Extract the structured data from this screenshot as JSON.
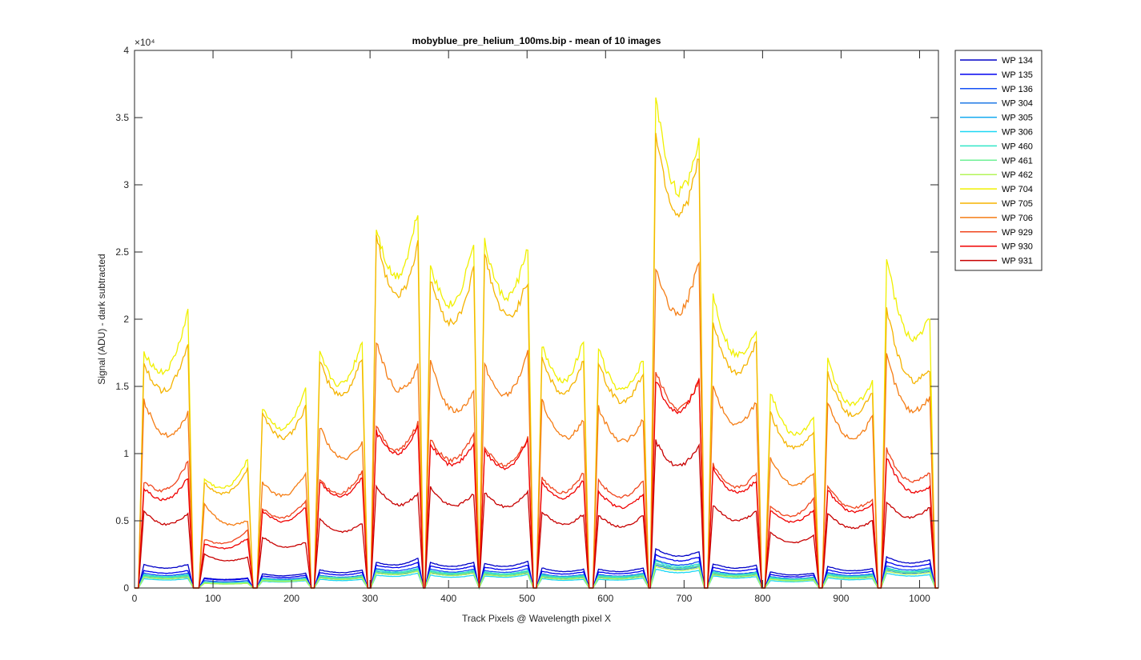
{
  "chart_data": {
    "type": "line",
    "title": "mobyblue_pre_helium_100ms.bip - mean of 10 images",
    "xlabel": "Track Pixels @ Wavelength pixel X",
    "ylabel": "Signal (ADU) - dark subtracted",
    "y_multiplier_label": "×10⁴",
    "xlim": [
      0,
      1024
    ],
    "ylim": [
      0,
      40000
    ],
    "x_ticks": [
      0,
      100,
      200,
      300,
      400,
      500,
      600,
      700,
      800,
      900,
      1000
    ],
    "y_ticks": [
      0,
      5000,
      10000,
      15000,
      20000,
      25000,
      30000,
      35000,
      40000
    ],
    "y_tick_labels": [
      "0",
      "0.5",
      "1",
      "1.5",
      "2",
      "2.5",
      "3",
      "3.5",
      "4"
    ],
    "grid": false,
    "legend_position": "outside-top-right",
    "segments_x": [
      [
        12,
        68
      ],
      [
        89,
        144
      ],
      [
        163,
        218
      ],
      [
        236,
        290
      ],
      [
        308,
        361
      ],
      [
        377,
        432
      ],
      [
        446,
        501
      ],
      [
        519,
        572
      ],
      [
        591,
        648
      ],
      [
        664,
        719
      ],
      [
        737,
        792
      ],
      [
        810,
        865
      ],
      [
        883,
        940
      ],
      [
        958,
        1013
      ]
    ],
    "series": [
      {
        "name": "WP 134",
        "color": "#0000c8",
        "levels": [
          [
            1750,
            1750
          ],
          [
            750,
            750
          ],
          [
            1050,
            1100
          ],
          [
            1350,
            1350
          ],
          [
            1900,
            2200
          ],
          [
            1900,
            1900
          ],
          [
            1800,
            2000
          ],
          [
            1500,
            1400
          ],
          [
            1400,
            1500
          ],
          [
            2900,
            2700
          ],
          [
            1800,
            1700
          ],
          [
            1200,
            1100
          ],
          [
            1600,
            1450
          ],
          [
            2300,
            2100
          ]
        ]
      },
      {
        "name": "WP 135",
        "color": "#0000f0",
        "levels": [
          [
            1300,
            1300
          ],
          [
            700,
            700
          ],
          [
            900,
            950
          ],
          [
            1150,
            1150
          ],
          [
            1700,
            1900
          ],
          [
            1650,
            1650
          ],
          [
            1550,
            1700
          ],
          [
            1250,
            1200
          ],
          [
            1200,
            1300
          ],
          [
            2500,
            2300
          ],
          [
            1550,
            1450
          ],
          [
            1000,
            950
          ],
          [
            1350,
            1250
          ],
          [
            1950,
            1800
          ]
        ]
      },
      {
        "name": "WP 136",
        "color": "#1450f5",
        "levels": [
          [
            1100,
            1100
          ],
          [
            550,
            550
          ],
          [
            750,
            800
          ],
          [
            950,
            950
          ],
          [
            1450,
            1600
          ],
          [
            1400,
            1400
          ],
          [
            1300,
            1450
          ],
          [
            1050,
            1000
          ],
          [
            1000,
            1100
          ],
          [
            2100,
            1950
          ],
          [
            1300,
            1200
          ],
          [
            850,
            800
          ],
          [
            1150,
            1050
          ],
          [
            1650,
            1500
          ]
        ]
      },
      {
        "name": "WP 304",
        "color": "#1e78e6",
        "levels": [
          [
            850,
            850
          ],
          [
            400,
            400
          ],
          [
            600,
            650
          ],
          [
            800,
            800
          ],
          [
            1150,
            1300
          ],
          [
            1150,
            1150
          ],
          [
            1050,
            1150
          ],
          [
            850,
            800
          ],
          [
            800,
            900
          ],
          [
            1700,
            1600
          ],
          [
            1050,
            1000
          ],
          [
            700,
            650
          ],
          [
            950,
            850
          ],
          [
            1350,
            1250
          ]
        ]
      },
      {
        "name": "WP 305",
        "color": "#14aaf0",
        "levels": [
          [
            950,
            950
          ],
          [
            450,
            450
          ],
          [
            650,
            700
          ],
          [
            850,
            850
          ],
          [
            1250,
            1400
          ],
          [
            1250,
            1250
          ],
          [
            1150,
            1250
          ],
          [
            950,
            900
          ],
          [
            900,
            1000
          ],
          [
            1850,
            1700
          ],
          [
            1150,
            1100
          ],
          [
            750,
            700
          ],
          [
            1000,
            950
          ],
          [
            1450,
            1350
          ]
        ]
      },
      {
        "name": "WP 306",
        "color": "#1ed7f5",
        "levels": [
          [
            700,
            700
          ],
          [
            350,
            350
          ],
          [
            500,
            550
          ],
          [
            650,
            650
          ],
          [
            950,
            1100
          ],
          [
            950,
            950
          ],
          [
            900,
            1000
          ],
          [
            700,
            650
          ],
          [
            650,
            750
          ],
          [
            1400,
            1300
          ],
          [
            900,
            850
          ],
          [
            550,
            550
          ],
          [
            750,
            700
          ],
          [
            1100,
            1000
          ]
        ]
      },
      {
        "name": "WP 460",
        "color": "#32e6c8",
        "levels": [
          [
            1000,
            1000
          ],
          [
            450,
            450
          ],
          [
            700,
            700
          ],
          [
            900,
            900
          ],
          [
            1350,
            1450
          ],
          [
            1300,
            1300
          ],
          [
            1200,
            1300
          ],
          [
            1000,
            950
          ],
          [
            950,
            1050
          ],
          [
            2000,
            1800
          ],
          [
            1200,
            1150
          ],
          [
            800,
            750
          ],
          [
            1050,
            1000
          ],
          [
            1500,
            1400
          ]
        ]
      },
      {
        "name": "WP 461",
        "color": "#6ef096",
        "levels": [
          [
            900,
            900
          ],
          [
            400,
            400
          ],
          [
            600,
            650
          ],
          [
            850,
            850
          ],
          [
            1200,
            1350
          ],
          [
            1200,
            1200
          ],
          [
            1100,
            1200
          ],
          [
            900,
            850
          ],
          [
            850,
            950
          ],
          [
            1800,
            1650
          ],
          [
            1100,
            1050
          ],
          [
            700,
            700
          ],
          [
            950,
            900
          ],
          [
            1400,
            1300
          ]
        ]
      },
      {
        "name": "WP 462",
        "color": "#b4f55a",
        "levels": [
          [
            800,
            800
          ],
          [
            350,
            350
          ],
          [
            550,
            600
          ],
          [
            750,
            750
          ],
          [
            1100,
            1250
          ],
          [
            1100,
            1100
          ],
          [
            1000,
            1100
          ],
          [
            800,
            750
          ],
          [
            750,
            850
          ],
          [
            1600,
            1500
          ],
          [
            1000,
            950
          ],
          [
            650,
            600
          ],
          [
            850,
            800
          ],
          [
            1250,
            1150
          ]
        ]
      },
      {
        "name": "WP 704",
        "color": "#f0f000",
        "levels": [
          [
            17600,
            20600
          ],
          [
            8100,
            9600
          ],
          [
            13400,
            14700
          ],
          [
            17400,
            18400
          ],
          [
            26800,
            28100
          ],
          [
            24000,
            25900
          ],
          [
            25700,
            25400
          ],
          [
            18000,
            18400
          ],
          [
            17800,
            17000
          ],
          [
            36400,
            33400
          ],
          [
            21800,
            19300
          ],
          [
            14600,
            12600
          ],
          [
            16900,
            15400
          ],
          [
            24500,
            20000
          ]
        ]
      },
      {
        "name": "WP 705",
        "color": "#f5b400",
        "levels": [
          [
            16600,
            18200
          ],
          [
            7800,
            8900
          ],
          [
            13000,
            13500
          ],
          [
            16800,
            17200
          ],
          [
            26100,
            25500
          ],
          [
            23000,
            23700
          ],
          [
            24900,
            22900
          ],
          [
            17200,
            17000
          ],
          [
            16800,
            16000
          ],
          [
            33900,
            32000
          ],
          [
            19600,
            18300
          ],
          [
            13000,
            11700
          ],
          [
            16000,
            14600
          ],
          [
            20800,
            16300
          ]
        ]
      },
      {
        "name": "WP 706",
        "color": "#f57d14",
        "levels": [
          [
            13900,
            13000
          ],
          [
            6300,
            5000
          ],
          [
            7800,
            8500
          ],
          [
            12000,
            10800
          ],
          [
            18400,
            16500
          ],
          [
            16800,
            14600
          ],
          [
            16500,
            17500
          ],
          [
            14000,
            12500
          ],
          [
            13400,
            12500
          ],
          [
            23800,
            24400
          ],
          [
            14900,
            13900
          ],
          [
            9700,
            8500
          ],
          [
            13700,
            12700
          ],
          [
            17300,
            14200
          ]
        ]
      },
      {
        "name": "WP 929",
        "color": "#f0461e",
        "levels": [
          [
            7900,
            9400
          ],
          [
            3600,
            4300
          ],
          [
            5900,
            6500
          ],
          [
            8000,
            8700
          ],
          [
            12000,
            12300
          ],
          [
            11000,
            11500
          ],
          [
            10500,
            11200
          ],
          [
            8200,
            8600
          ],
          [
            8000,
            8000
          ],
          [
            16200,
            15400
          ],
          [
            9200,
            8500
          ],
          [
            6100,
            6600
          ],
          [
            7600,
            6600
          ],
          [
            10300,
            8600
          ]
        ]
      },
      {
        "name": "WP 930",
        "color": "#f00000",
        "levels": [
          [
            7400,
            8200
          ],
          [
            3300,
            3700
          ],
          [
            5700,
            6000
          ],
          [
            7900,
            8200
          ],
          [
            11600,
            12000
          ],
          [
            10800,
            10800
          ],
          [
            10200,
            11000
          ],
          [
            7800,
            8000
          ],
          [
            7200,
            7000
          ],
          [
            15500,
            15400
          ],
          [
            8900,
            8000
          ],
          [
            5800,
            5800
          ],
          [
            7300,
            6200
          ],
          [
            9700,
            7500
          ]
        ]
      },
      {
        "name": "WP 931",
        "color": "#c80000",
        "levels": [
          [
            5700,
            5500
          ],
          [
            2500,
            2300
          ],
          [
            3800,
            3400
          ],
          [
            5100,
            4800
          ],
          [
            7600,
            7000
          ],
          [
            7500,
            7000
          ],
          [
            7100,
            7200
          ],
          [
            5700,
            5500
          ],
          [
            5400,
            5400
          ],
          [
            10900,
            10600
          ],
          [
            6200,
            5700
          ],
          [
            4100,
            3900
          ],
          [
            5600,
            5000
          ],
          [
            6400,
            6000
          ]
        ]
      }
    ]
  }
}
